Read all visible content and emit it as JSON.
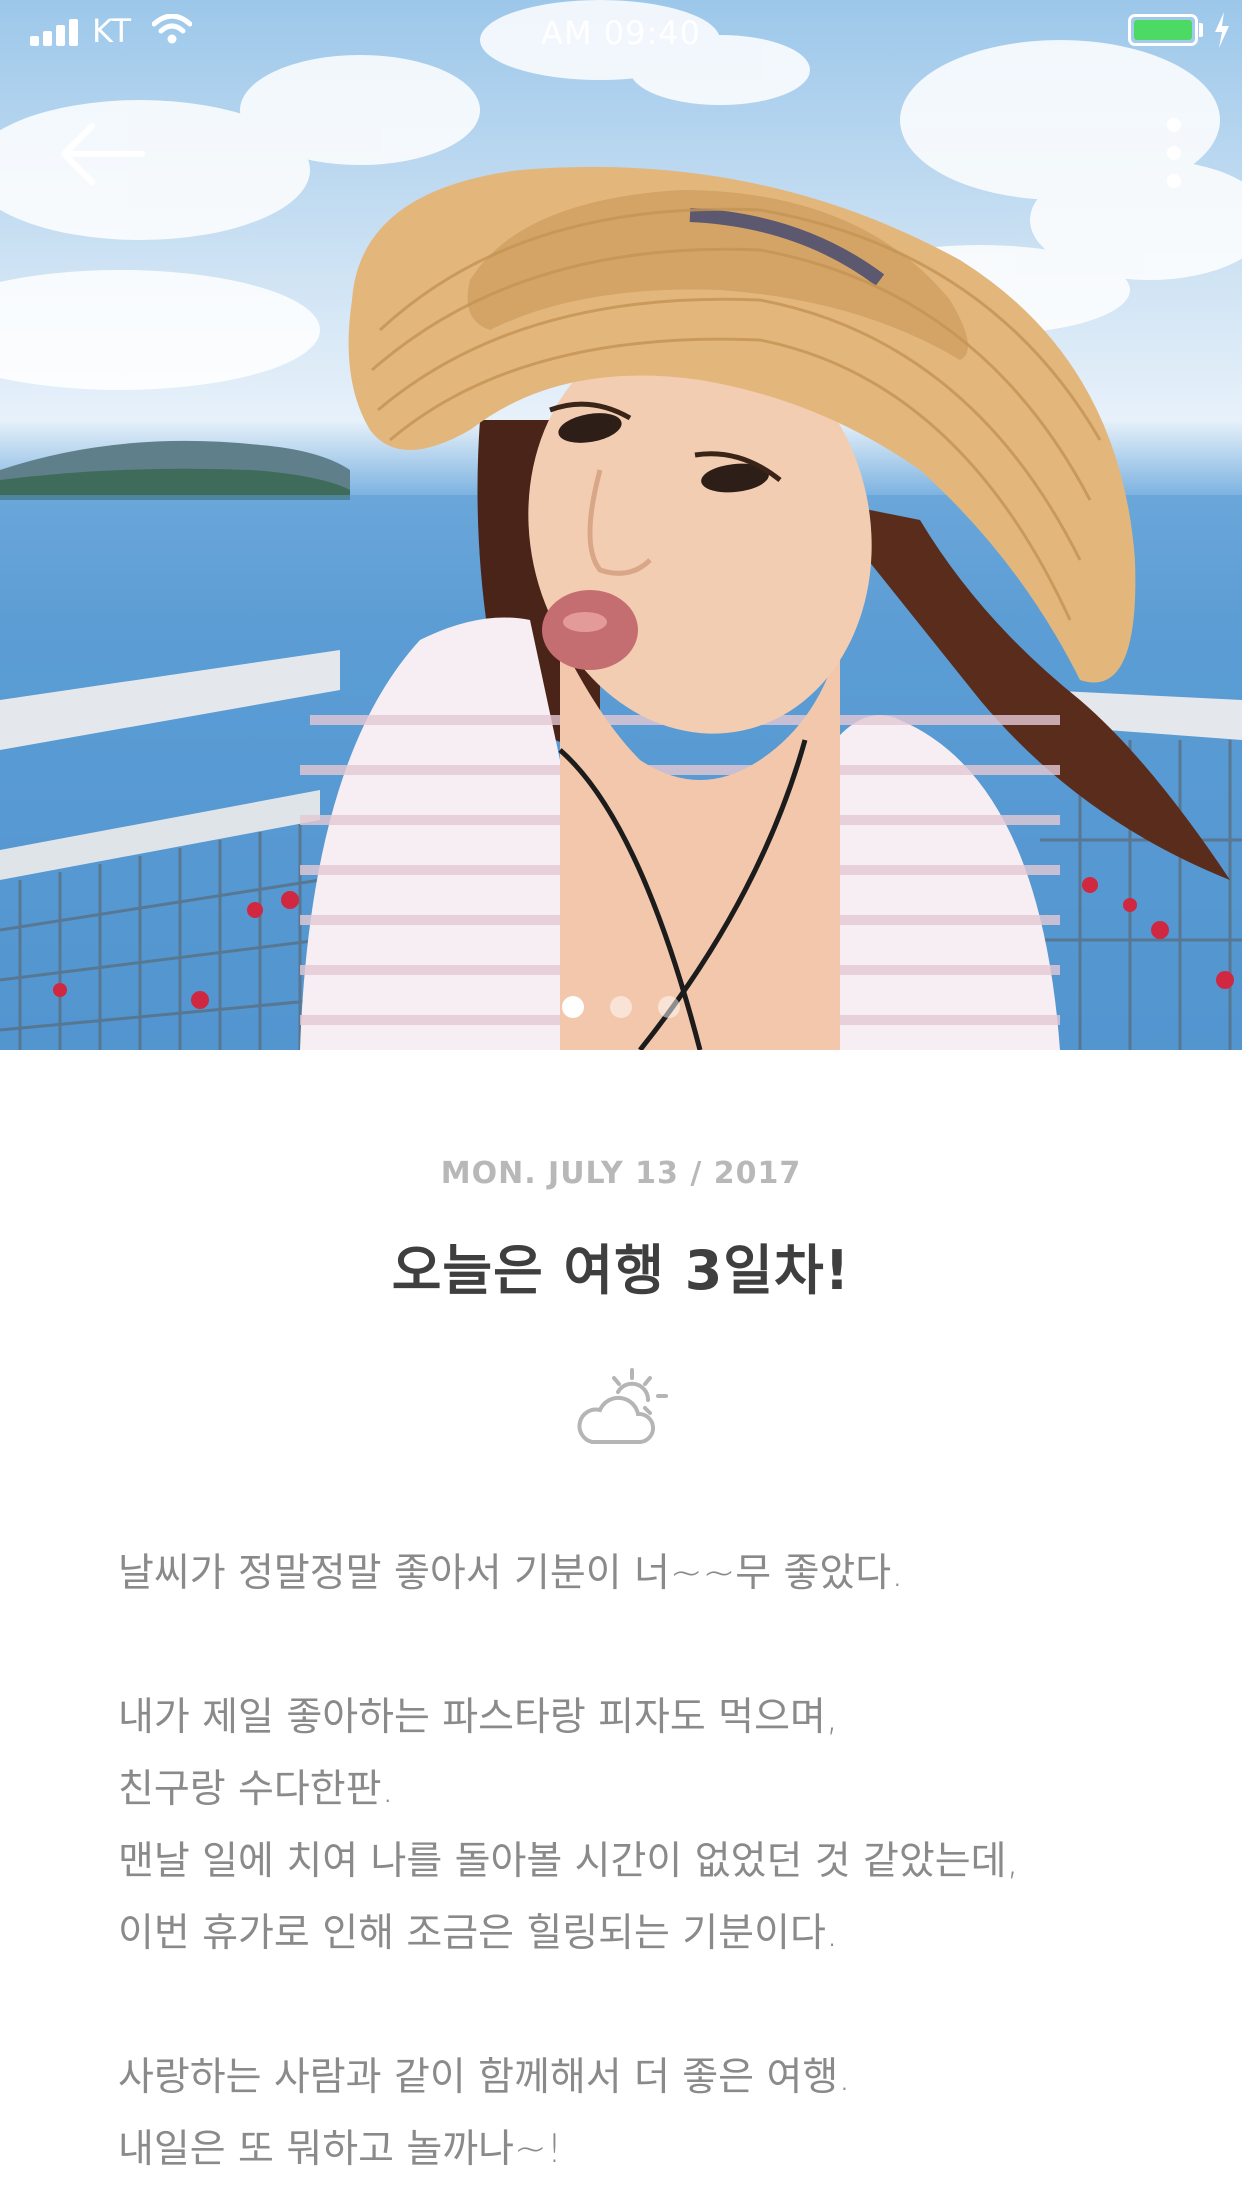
{
  "status_bar": {
    "carrier": "KT",
    "time": "AM 09:40",
    "battery_level": 1.0,
    "battery_color": "#4cd964"
  },
  "nav": {
    "back_icon": "arrow-left-icon",
    "more_icon": "more-vertical-icon"
  },
  "gallery": {
    "page_count": 3,
    "active_index": 0
  },
  "post": {
    "date": "MON. JULY 13 / 2017",
    "title": "오늘은 여행 3일차!",
    "weather_icon": "partly-cloudy-icon",
    "paragraphs": [
      [
        "날씨가 정말정말 좋아서 기분이 너~~무 좋았다."
      ],
      [
        "내가 제일 좋아하는 파스타랑 피자도 먹으며,",
        "친구랑 수다한판.",
        "맨날 일에 치여 나를 돌아볼 시간이 없었던 것 같았는데,",
        "이번 휴가로 인해 조금은 힐링되는 기분이다."
      ],
      [
        "사랑하는 사람과 같이 함께해서 더 좋은 여행.",
        "내일은 또 뭐하고 놀까나~!"
      ]
    ]
  },
  "colors": {
    "title": "#3f3f3f",
    "date": "#b8b8b8",
    "body": "#8a8a8a"
  }
}
